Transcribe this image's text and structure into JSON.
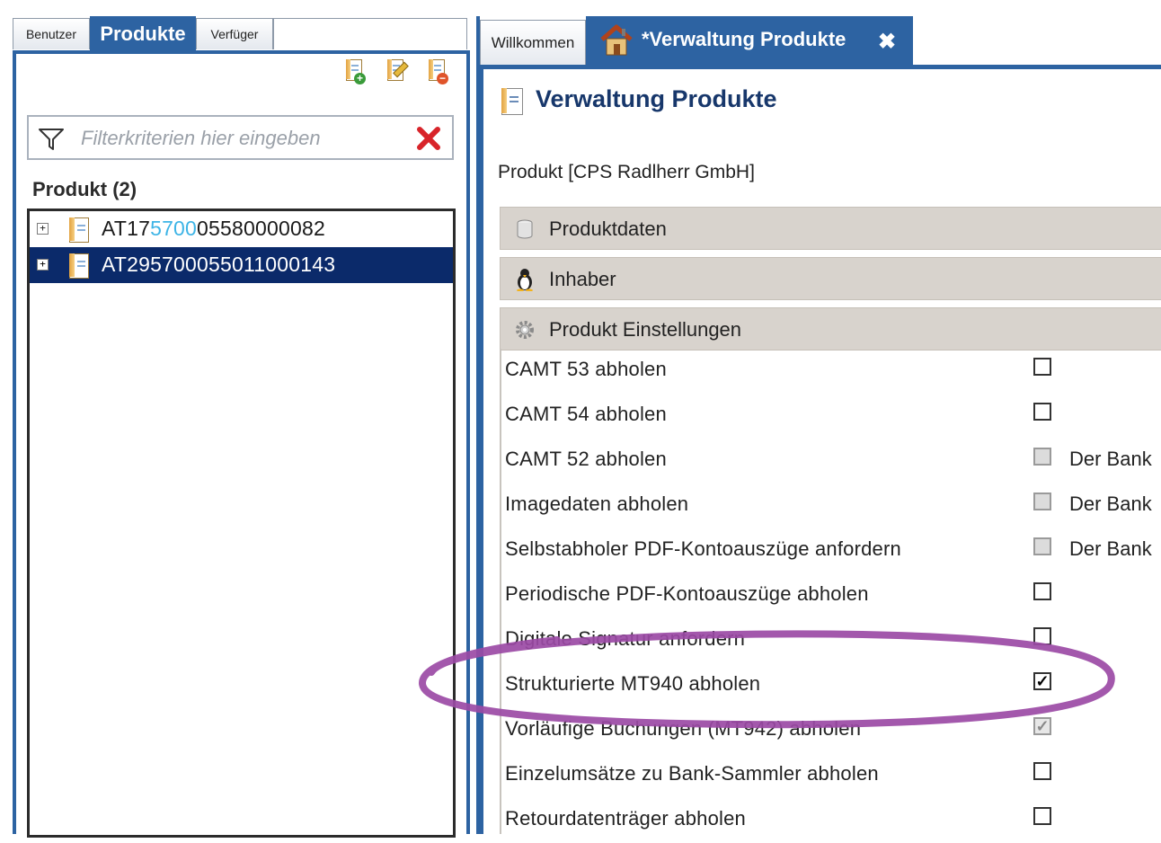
{
  "left_panel": {
    "tabs": [
      {
        "label": "Benutzer"
      },
      {
        "label": "Produkte",
        "active": true
      },
      {
        "label": "Verfüger"
      }
    ],
    "toolbar": [
      {
        "icon": "add-product-icon"
      },
      {
        "icon": "edit-product-icon"
      },
      {
        "icon": "delete-product-icon"
      }
    ],
    "filter": {
      "placeholder": "Filterkriterien hier eingeben",
      "value": ""
    },
    "heading": "Produkt (2)",
    "tree": [
      {
        "prefix": "AT17",
        "highlight": "5700",
        "suffix": "05580000082",
        "selected": false
      },
      {
        "prefix": "AT29570005501100014",
        "highlight": "",
        "suffix": "3",
        "selected": true
      }
    ]
  },
  "right_panel": {
    "tabs": [
      {
        "label": "Willkommen"
      },
      {
        "label": "*Verwaltung Produkte",
        "active": true,
        "closable": true
      }
    ],
    "page_title": "Verwaltung Produkte",
    "entity_label": "Produkt [CPS Radlherr GmbH]",
    "sections": [
      {
        "label": "Produktdaten",
        "icon": "database-icon"
      },
      {
        "label": "Inhaber",
        "icon": "person-icon"
      },
      {
        "label": "Produkt Einstellungen",
        "icon": "gear-icon"
      }
    ],
    "settings": [
      {
        "label": "CAMT 53 abholen",
        "checked": false,
        "disabled": false,
        "note": ""
      },
      {
        "label": "CAMT 54 abholen",
        "checked": false,
        "disabled": false,
        "note": ""
      },
      {
        "label": "CAMT 52 abholen",
        "checked": false,
        "disabled": true,
        "note": "Der Bank"
      },
      {
        "label": "Imagedaten abholen",
        "checked": false,
        "disabled": true,
        "note": "Der Bank"
      },
      {
        "label": "Selbstabholer PDF-Kontoauszüge anfordern",
        "checked": false,
        "disabled": true,
        "note": "Der Bank"
      },
      {
        "label": "Periodische PDF-Kontoauszüge abholen",
        "checked": false,
        "disabled": false,
        "note": ""
      },
      {
        "label": "Digitale Signatur anfordern",
        "checked": false,
        "disabled": false,
        "note": ""
      },
      {
        "label": "Strukturierte MT940 abholen",
        "checked": true,
        "disabled": false,
        "note": ""
      },
      {
        "label": "Vorläufige Buchungen (MT942) abholen",
        "checked": true,
        "disabled": true,
        "note": ""
      },
      {
        "label": "Einzelumsätze zu Bank-Sammler abholen",
        "checked": false,
        "disabled": false,
        "note": ""
      },
      {
        "label": "Retourdatenträger abholen",
        "checked": false,
        "disabled": false,
        "note": ""
      }
    ],
    "accent_color": "#2d63a2",
    "annotation_color": "#9b4aa5"
  }
}
